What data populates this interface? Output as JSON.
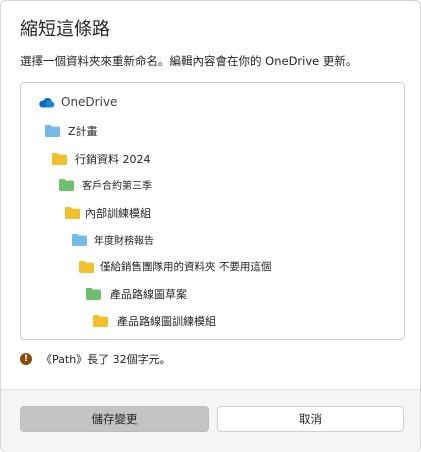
{
  "dialog": {
    "title": "縮短這條路",
    "subtitle": "選擇一個資料夾來重新命名。編輯內容會在你的 OneDrive 更新。",
    "warning": "《Path》長了 32個字元。",
    "save_label": "儲存變更",
    "cancel_label": "取消"
  },
  "tree": {
    "root": {
      "label": "OneDrive",
      "icon": "cloud-icon",
      "color": "#0f6cbd"
    },
    "items": [
      {
        "label": "Z計畫",
        "icon": "folder-icon",
        "color": "#73b9ea"
      },
      {
        "label": "行銷資料 2024",
        "icon": "folder-icon",
        "color": "#f2c02a"
      },
      {
        "label": "客戶合約第三季",
        "icon": "folder-icon",
        "color": "#6dc06e"
      },
      {
        "label": "內部訓練模組",
        "icon": "folder-icon",
        "color": "#f2c02a"
      },
      {
        "label": "年度財務報告",
        "icon": "folder-icon",
        "color": "#73b9ea"
      },
      {
        "label": "僅給銷售團隊用的資料夾 不要用這個",
        "icon": "folder-icon",
        "color": "#f2c02a"
      },
      {
        "label": "產品路線圖草案",
        "icon": "folder-icon",
        "color": "#6dc06e"
      },
      {
        "label": "產品路線圖訓練模組",
        "icon": "folder-icon",
        "color": "#f2c02a"
      }
    ]
  },
  "colors": {
    "warning_icon": "#8a4b08",
    "save_button_bg": "#c4c4c4",
    "footer_bg": "#f5f5f5"
  }
}
